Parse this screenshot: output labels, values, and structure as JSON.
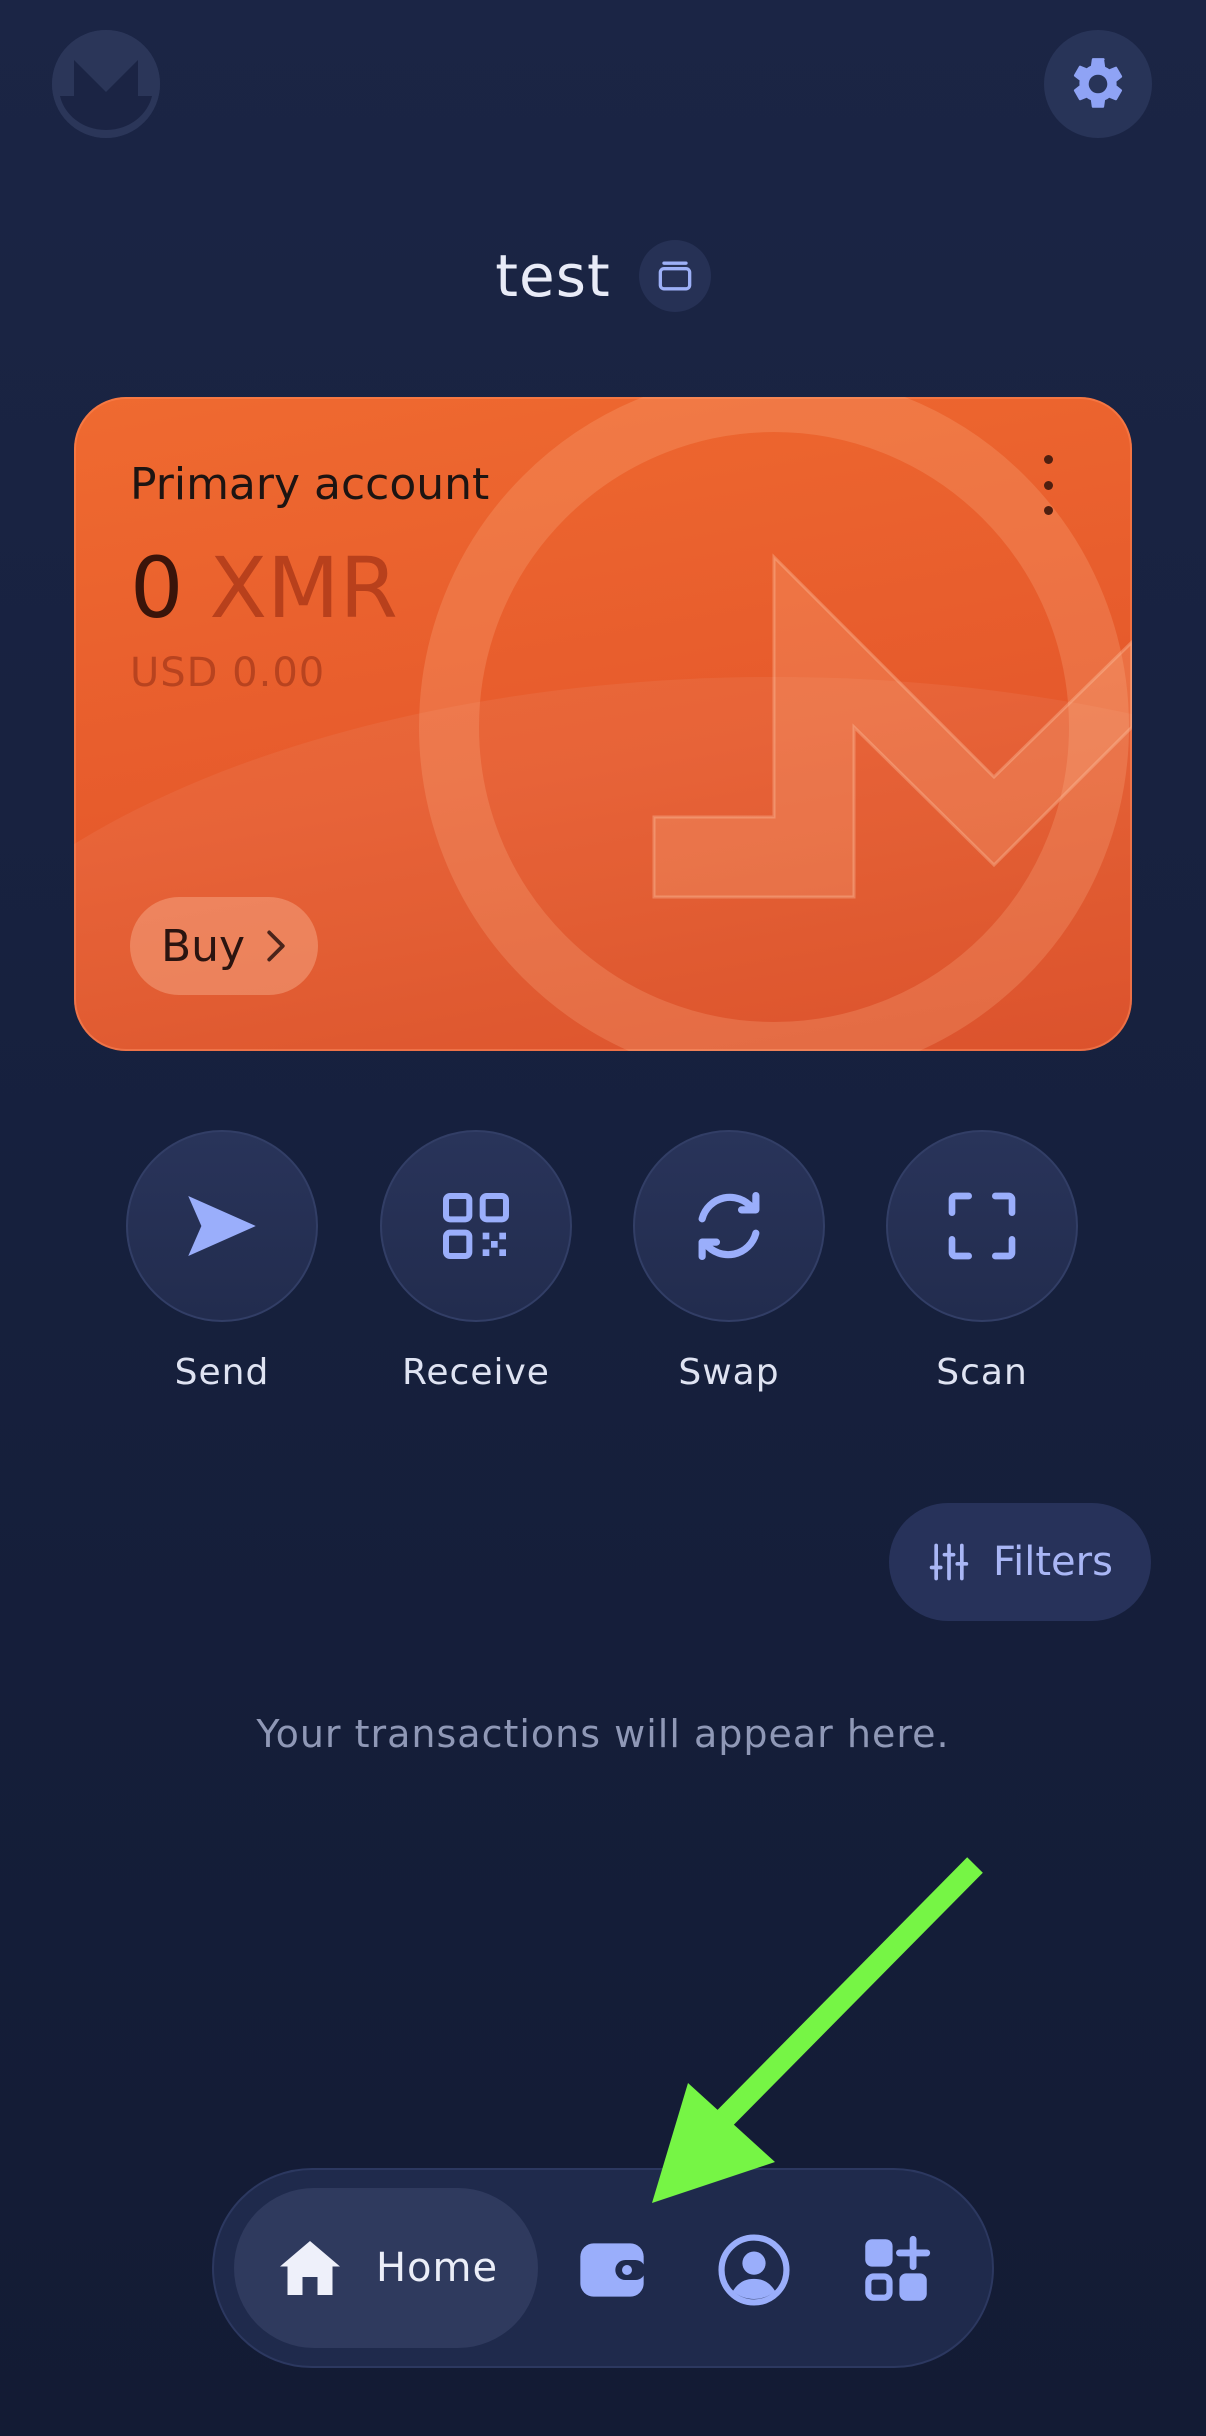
{
  "header": {
    "logo_icon": "monero-logo-icon",
    "settings_icon": "gear-icon"
  },
  "wallet": {
    "name": "test",
    "switch_icon": "wallet-switch-icon"
  },
  "account_card": {
    "title": "Primary account",
    "balance_amount": "0",
    "balance_unit": "XMR",
    "fiat_balance": "USD 0.00",
    "buy_label": "Buy",
    "accent_color": "#e8602c"
  },
  "actions": [
    {
      "label": "Send",
      "icon": "send-icon"
    },
    {
      "label": "Receive",
      "icon": "qr-code-icon"
    },
    {
      "label": "Swap",
      "icon": "swap-icon"
    },
    {
      "label": "Scan",
      "icon": "scan-icon"
    }
  ],
  "transactions": {
    "filters_label": "Filters",
    "empty_message": "Your transactions will appear here."
  },
  "bottom_nav": {
    "items": [
      {
        "label": "Home",
        "icon": "home-icon",
        "active": true
      },
      {
        "label": "",
        "icon": "wallet-icon",
        "active": false
      },
      {
        "label": "",
        "icon": "account-icon",
        "active": false
      },
      {
        "label": "",
        "icon": "apps-icon",
        "active": false
      }
    ]
  },
  "annotation": {
    "arrow_color": "#76f545"
  }
}
